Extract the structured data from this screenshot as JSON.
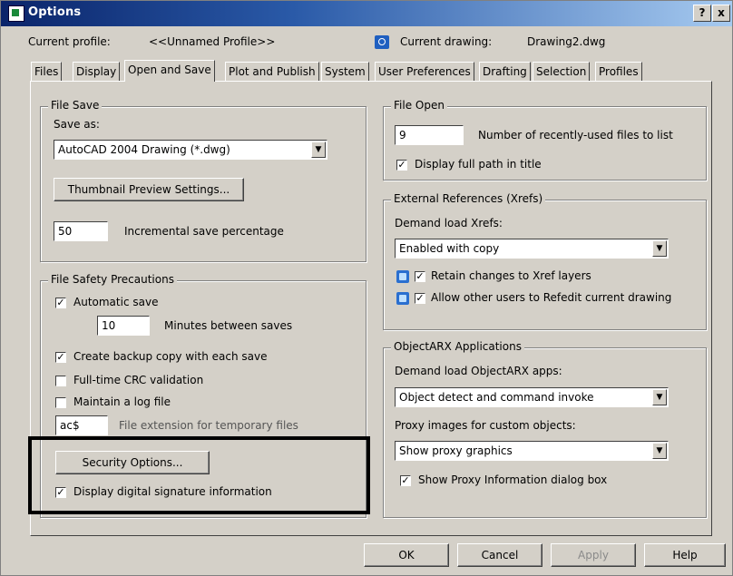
{
  "window": {
    "title": "Options",
    "help_btn": "?",
    "close_btn": "x"
  },
  "header": {
    "current_profile_label": "Current profile:",
    "current_profile_value": "<<Unnamed Profile>>",
    "current_drawing_label": "Current drawing:",
    "current_drawing_value": "Drawing2.dwg"
  },
  "tabs": [
    "Files",
    "Display",
    "Open and Save",
    "Plot and Publish",
    "System",
    "User Preferences",
    "Drafting",
    "Selection",
    "Profiles"
  ],
  "active_tab": "Open and Save",
  "file_save": {
    "title": "File Save",
    "save_as_label": "Save as:",
    "save_as_value": "AutoCAD 2004 Drawing (*.dwg)",
    "thumbnail_button": "Thumbnail Preview Settings...",
    "incremental_value": "50",
    "incremental_label": "Incremental save percentage"
  },
  "file_safety": {
    "title": "File Safety Precautions",
    "automatic_save": {
      "label": "Automatic save",
      "checked": true
    },
    "minutes_value": "10",
    "minutes_label": "Minutes between saves",
    "backup": {
      "label": "Create backup copy with each save",
      "checked": true
    },
    "crc": {
      "label": "Full-time CRC validation",
      "checked": false
    },
    "logfile": {
      "label": "Maintain a log file",
      "checked": false
    },
    "temp_ext_value": "ac$",
    "temp_ext_label": "File extension for temporary files",
    "security_button": "Security Options...",
    "digital_sig": {
      "label": "Display digital signature information",
      "checked": true
    }
  },
  "file_open": {
    "title": "File Open",
    "recent_value": "9",
    "recent_label": "Number of recently-used files to list",
    "fullpath": {
      "label": "Display full path in title",
      "checked": true
    }
  },
  "xrefs": {
    "title": "External References (Xrefs)",
    "demand_label": "Demand load Xrefs:",
    "demand_value": "Enabled with copy",
    "retain": {
      "label": "Retain changes to Xref layers",
      "checked": true
    },
    "allow": {
      "label": "Allow other users to Refedit current drawing",
      "checked": true
    }
  },
  "objectarx": {
    "title": "ObjectARX Applications",
    "demand_label": "Demand load ObjectARX apps:",
    "demand_value": "Object detect and command invoke",
    "proxy_label": "Proxy images for custom objects:",
    "proxy_value": "Show proxy graphics",
    "proxy_info": {
      "label": "Show Proxy Information dialog box",
      "checked": true
    }
  },
  "footer": {
    "ok": "OK",
    "cancel": "Cancel",
    "apply": "Apply",
    "help": "Help"
  }
}
